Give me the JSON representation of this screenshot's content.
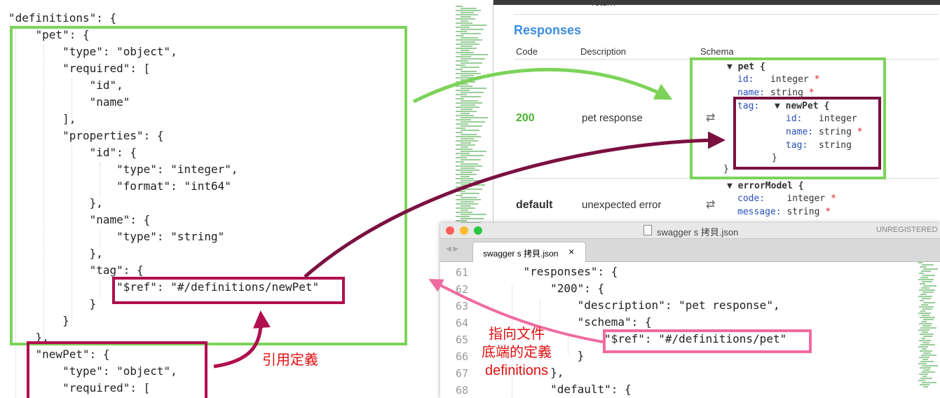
{
  "left_code": [
    "\"definitions\": {",
    "    \"pet\": {",
    "        \"type\": \"object\",",
    "        \"required\": [",
    "            \"id\",",
    "            \"name\"",
    "        ],",
    "        \"properties\": {",
    "            \"id\": {",
    "                \"type\": \"integer\",",
    "                \"format\": \"int64\"",
    "            },",
    "            \"name\": {",
    "                \"type\": \"string\"",
    "            },",
    "            \"tag\": {",
    "                \"$ref\": \"#/definitions/newPet\"",
    "            }",
    "        }",
    "    },",
    "    \"newPet\": {",
    "        \"type\": \"object\",",
    "        \"required\": ["
  ],
  "swagger": {
    "cut_text": "return",
    "responses_title": "Responses",
    "headers": {
      "code": "Code",
      "description": "Description",
      "schema": "Schema"
    },
    "rows": [
      {
        "code": "200",
        "description": "pet response"
      },
      {
        "code": "default",
        "description": "unexpected error"
      }
    ],
    "swap_symbol": "⇄",
    "pet_model": {
      "name": "pet {",
      "id_key": "id:",
      "id_type": "integer",
      "name_key": "name:",
      "name_type": "string",
      "tag_key": "tag:",
      "close": "}"
    },
    "newpet_model": {
      "name": "newPet {",
      "id_key": "id:",
      "id_type": "integer",
      "name_key": "name:",
      "name_type": "string",
      "tag_key": "tag:",
      "tag_type": "string",
      "close": "}"
    },
    "error_model": {
      "name": "errorModel {",
      "code_key": "code:",
      "code_type": "integer",
      "message_key": "message:",
      "message_type": "string"
    },
    "required_mark": "*",
    "collapse_glyph": "▼"
  },
  "editor": {
    "window_title": "swagger s 拷貝.json",
    "unregistered": "UNREGISTERED",
    "tab_label": "swagger s 拷貝.json",
    "tab_close": "×",
    "line_numbers": [
      "61",
      "62",
      "63",
      "64",
      "65",
      "66",
      "67",
      "68"
    ],
    "lines": [
      "    \"responses\": {",
      "        \"200\": {",
      "            \"description\": \"pet response\",",
      "            \"schema\": {",
      "                \"$ref\": \"#/definitions/pet\"",
      "            }",
      "        },",
      "        \"default\": {"
    ]
  },
  "annotations": {
    "ref_definition": "引用定義",
    "points_to_line1": "指向文件",
    "points_to_line2": "底端的定義",
    "points_to_line3": "definitions"
  },
  "colors": {
    "green_box": "#7dd35a",
    "maroon_box": "#7a1040",
    "pink_box": "#f06aa0",
    "crimson_box": "#b0104f",
    "annotation_text": "#e01010"
  }
}
